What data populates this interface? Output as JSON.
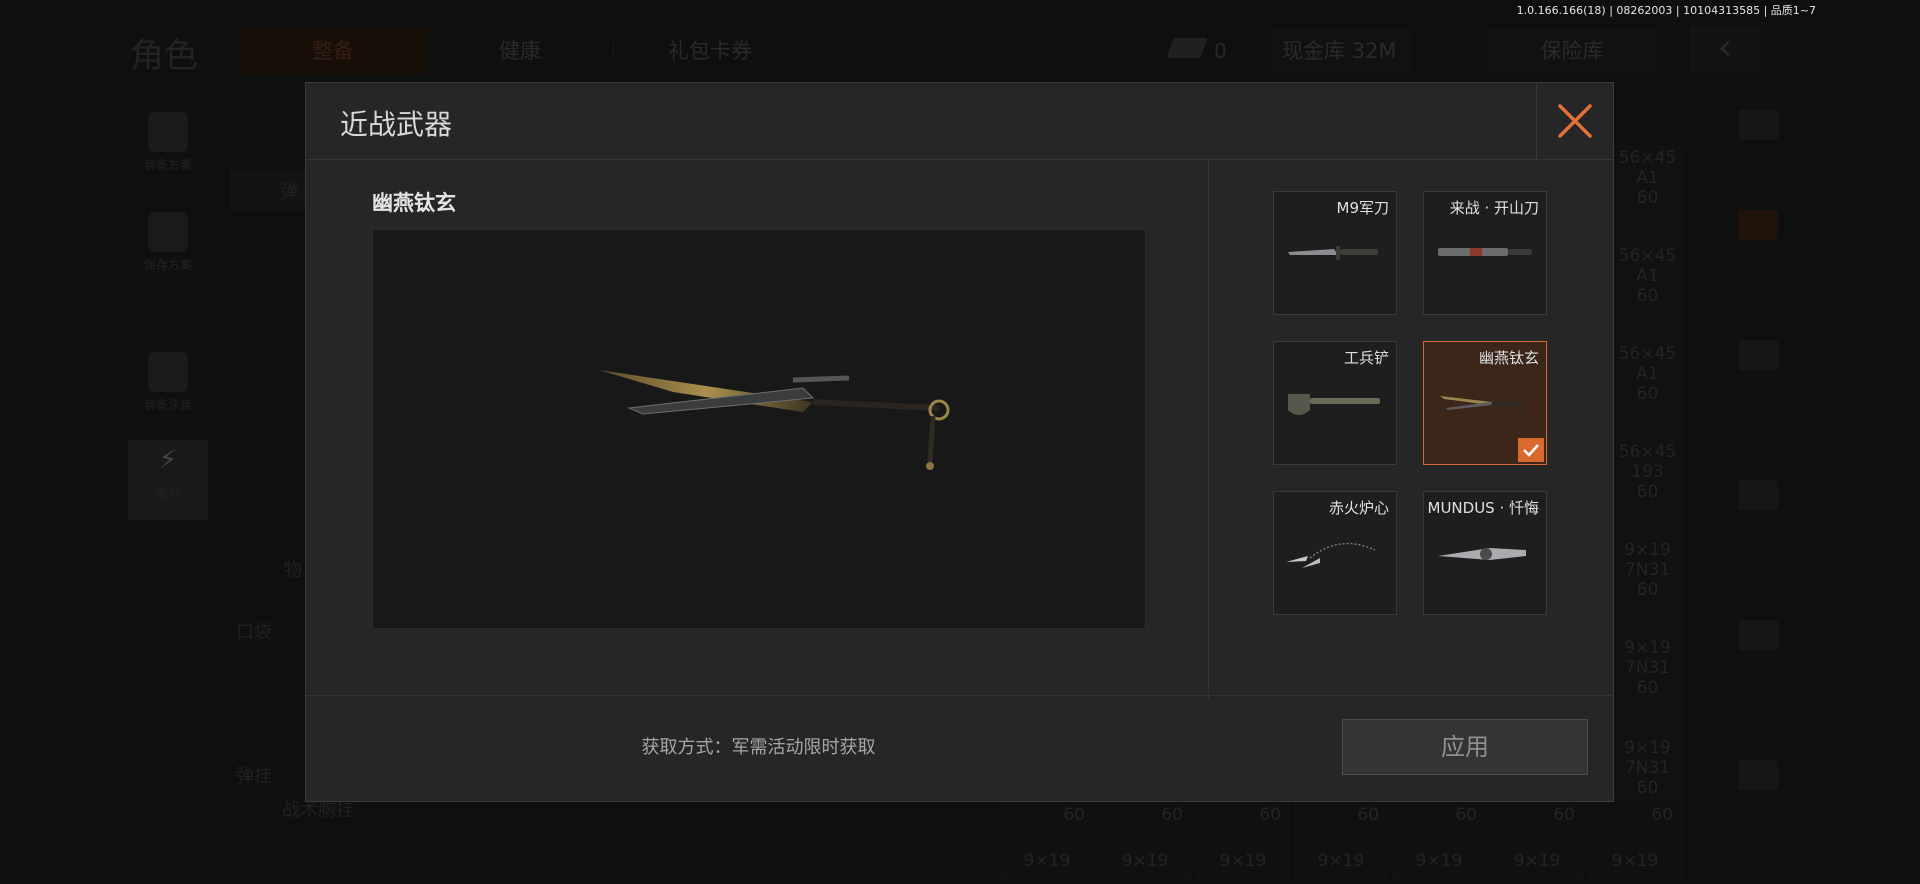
{
  "version_info": "1.0.166.166(18) | 08262003 | 10104313585 | 品质1~7",
  "background": {
    "title": "角色",
    "tabs": [
      "整备",
      "健康",
      "礼包卡券"
    ],
    "cash_count": "0",
    "cash_vault": "现金库 32M",
    "safe_vault": "保险库",
    "sidebar": [
      "装备方案",
      "保存方案",
      "装备涂装",
      "能力"
    ],
    "section_labels": {
      "ammo": "弹",
      "items": "物",
      "pocket": "口袋",
      "rig": "弹挂",
      "rig_sub": "战术胸挂"
    },
    "ammo_right": [
      {
        "cal": "56×45",
        "sub": "A1",
        "qty": "60"
      },
      {
        "cal": "56×45",
        "sub": "A1",
        "qty": "60"
      },
      {
        "cal": "56×45",
        "sub": "A1",
        "qty": "60"
      },
      {
        "cal": "56×45",
        "sub": "193",
        "qty": "60"
      },
      {
        "cal": "9×19",
        "sub": "7N31",
        "qty": "60"
      },
      {
        "cal": "9×19",
        "sub": "7N31",
        "qty": "60"
      },
      {
        "cal": "9×19",
        "sub": "7N31",
        "qty": "60"
      }
    ],
    "ammo_bottom": [
      {
        "qty": "60",
        "cal": "9×19"
      },
      {
        "qty": "60",
        "cal": "9×19"
      },
      {
        "qty": "60",
        "cal": "9×19"
      },
      {
        "qty": "60",
        "cal": "9×19"
      },
      {
        "qty": "60",
        "cal": "9×19"
      },
      {
        "qty": "60",
        "cal": "9×19"
      },
      {
        "qty": "60",
        "cal": "9×19"
      }
    ]
  },
  "modal": {
    "title": "近战武器",
    "preview_name": "幽燕钛玄",
    "weapons": [
      {
        "name": "M9军刀",
        "icon": "knife-icon",
        "selected": false
      },
      {
        "name": "来战 · 开山刀",
        "icon": "machete-icon",
        "selected": false
      },
      {
        "name": "工兵铲",
        "icon": "shovel-icon",
        "selected": false
      },
      {
        "name": "幽燕钛玄",
        "icon": "twin-blade-icon",
        "selected": true
      },
      {
        "name": "赤火炉心",
        "icon": "rope-dart-icon",
        "selected": false
      },
      {
        "name": "MUNDUS · 忏悔",
        "icon": "ornate-knife-icon",
        "selected": false
      }
    ],
    "acquire_text": "获取方式：军需活动限时获取",
    "apply_label": "应用"
  },
  "colors": {
    "accent": "#d9692d",
    "selected_bg": "#3b2619",
    "modal_bg": "#262626"
  }
}
